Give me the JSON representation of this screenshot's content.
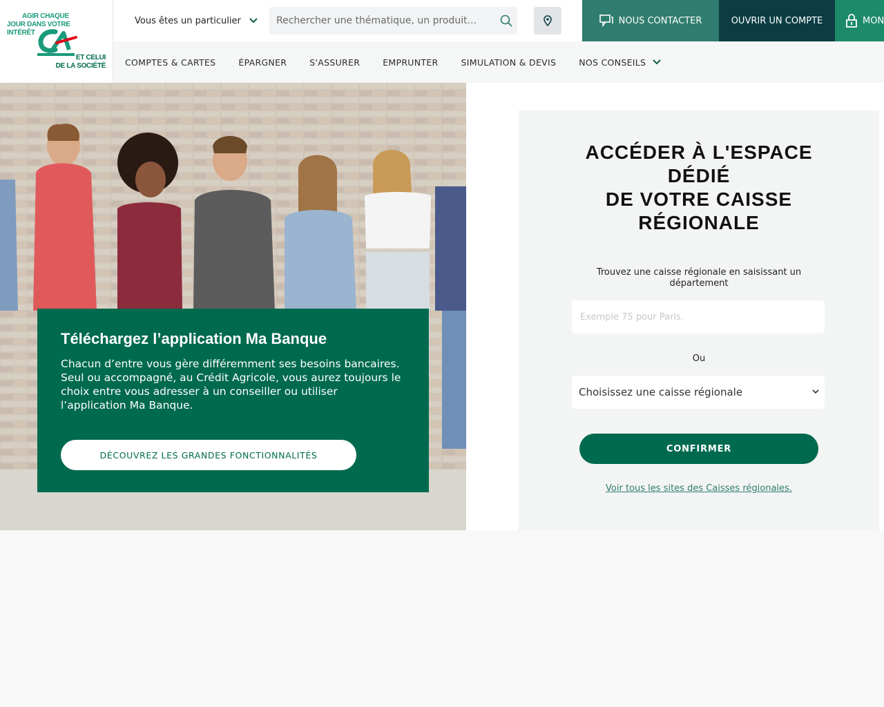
{
  "brand": {
    "tagline_top": [
      "AGIR CHAQUE",
      "JOUR DANS VOTRE",
      "INTÉRÊT"
    ],
    "logo_text": "CA",
    "tagline_bottom": [
      "ET CELUI",
      "DE LA SOCIÉTÉ"
    ],
    "color_primary": "#006a4e",
    "color_dark": "#0b3d43"
  },
  "topbar": {
    "profile_label": "Vous êtes un particulier",
    "search_placeholder": "Rechercher une thématique, un produit...",
    "contact_label": "NOUS CONTACTER",
    "open_account_label": "OUVRIR UN COMPTE",
    "my_account_label": "MON"
  },
  "nav": {
    "items": [
      {
        "label": "COMPTES & CARTES"
      },
      {
        "label": "ÉPARGNER"
      },
      {
        "label": "S'ASSURER"
      },
      {
        "label": "EMPRUNTER"
      },
      {
        "label": "SIMULATION & DEVIS"
      },
      {
        "label": "NOS CONSEILS"
      }
    ]
  },
  "promo": {
    "title": "Téléchargez l’application Ma Banque",
    "body": "Chacun d’entre vous gère différemment ses besoins bancaires. Seul ou accompagné, au Crédit Agricole, vous aurez toujours le choix entre vous adresser à un conseiller ou utiliser l’application Ma Banque.",
    "cta": "DÉCOUVREZ LES GRANDES FONCTIONNALITÉS"
  },
  "regional": {
    "title_lines": [
      "ACCÉDER À L'ESPACE DÉDIÉ",
      "DE VOTRE CAISSE RÉGIONALE"
    ],
    "hint": "Trouvez une caisse régionale en saisissant un département",
    "dept_placeholder": "Exemple 75 pour Paris.",
    "or_label": "Ou",
    "select_value": "Choisissez une caisse régionale",
    "confirm_label": "CONFIRMER",
    "all_sites_link": "Voir tous les sites des Caisses régionales."
  }
}
